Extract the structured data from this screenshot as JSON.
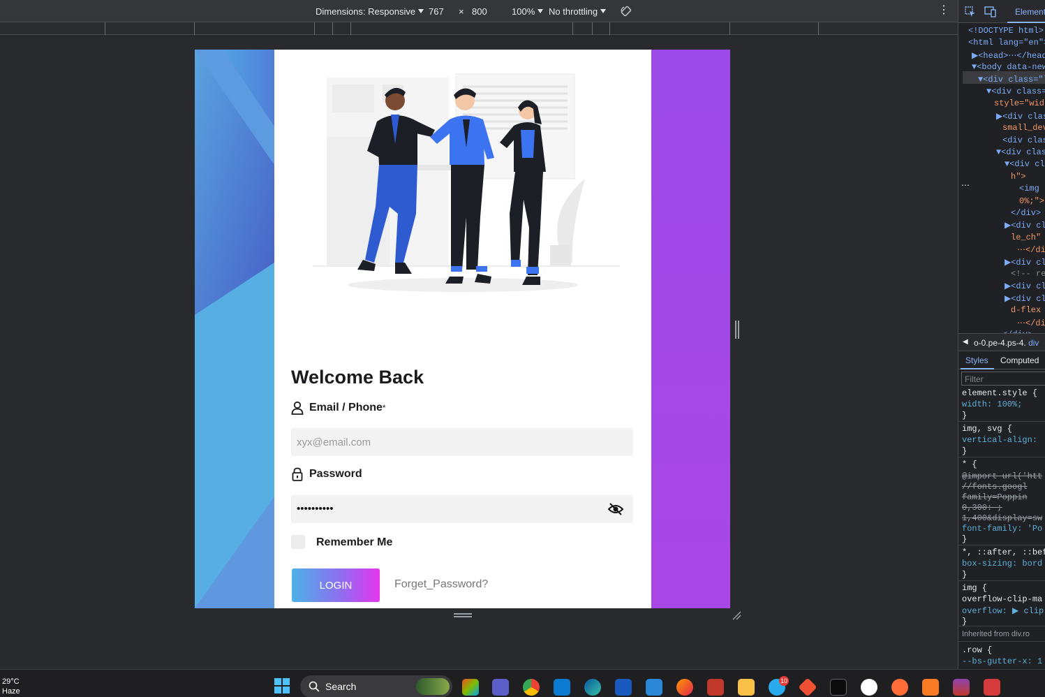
{
  "devtools": {
    "dimensions_label": "Dimensions: Responsive",
    "width_value": "767",
    "times": "×",
    "height_value": "800",
    "zoom": "100%",
    "throttling": "No throttling",
    "elements_tab": "Elements",
    "dom_lines": [
      {
        "t": "<!DOCTYPE html>"
      },
      {
        "t": "<html lang=\"en\">"
      },
      {
        "t": "▶<head>⋯</head>"
      },
      {
        "t": "▼<body data-new-"
      },
      {
        "t": "▼<div class=\"l"
      },
      {
        "t": "▼<div class="
      },
      {
        "t": "style=\"widt"
      },
      {
        "t": "▶<div class"
      },
      {
        "t": "small_devi"
      },
      {
        "t": "<div class"
      },
      {
        "t": "▼<div class"
      },
      {
        "t": "▼<div cla"
      },
      {
        "t": "h\">"
      },
      {
        "t": "<img s"
      },
      {
        "t": "0%;\">"
      },
      {
        "t": "</div>"
      },
      {
        "t": "▶<div cla"
      },
      {
        "t": "le_ch\" s"
      },
      {
        "t": "⋯</div"
      },
      {
        "t": "▶<div cla"
      },
      {
        "t": "<!-- res"
      },
      {
        "t": "▶<div cla"
      },
      {
        "t": "▶<div cla"
      },
      {
        "t": "d-flex a"
      },
      {
        "t": "⋯</div"
      },
      {
        "t": "</div>"
      }
    ],
    "breadcrumb": "o-0.pe-4.ps-4.",
    "breadcrumb_tail": "div",
    "styles_tab": "Styles",
    "computed_tab": "Computed",
    "filter_placeholder": "Filter",
    "css_lines": [
      {
        "t": "element.style {"
      },
      {
        "t": "  width: 100%;"
      },
      {
        "t": "}"
      },
      {
        "t": "img, svg {"
      },
      {
        "t": "  vertical-align:"
      },
      {
        "t": "}"
      },
      {
        "t": "* {"
      },
      {
        "t": "@import url('htt"
      },
      {
        "t": "  //fonts.googl"
      },
      {
        "t": "  family=Poppin"
      },
      {
        "t": "0,300: ;"
      },
      {
        "t": "1,400&display=sw"
      },
      {
        "t": "  font-family: 'Po"
      },
      {
        "t": "}"
      },
      {
        "t": "*, ::after, ::befo"
      },
      {
        "t": "  box-sizing: bord"
      },
      {
        "t": "}"
      },
      {
        "t": "img {"
      },
      {
        "t": "  overflow-clip-ma"
      },
      {
        "t": "  overflow: ▶ clip"
      },
      {
        "t": "}"
      },
      {
        "t": "Inherited from div.ro"
      },
      {
        "t": ".row {"
      },
      {
        "t": "  --bs-gutter-x: 1"
      }
    ]
  },
  "page": {
    "welcome": "Welcome Back",
    "email_label": "Email / Phone",
    "required_mark": "*",
    "email_placeholder": "xyx@email.com",
    "password_label": "Password",
    "password_value": "••••••••••",
    "remember_label": "Remember Me",
    "login_button": "LOGIN",
    "forgot_link": "Forget_Password?"
  },
  "taskbar": {
    "temperature": "29°C",
    "condition": "Haze",
    "search_label": "Search",
    "telegram_badge": "10",
    "apps": [
      "windows-icon",
      "copilot-icon",
      "teams-icon",
      "chrome-icon",
      "vscode-icon",
      "edge-icon",
      "word-icon",
      "terminal-app-icon",
      "firefox-icon",
      "app-icon",
      "file-explorer-icon",
      "telegram-icon",
      "git-icon",
      "cmd-icon",
      "mongodb-icon",
      "postman-icon",
      "xampp-icon",
      "winrar-icon",
      "snipping-icon"
    ]
  },
  "colors": {
    "accent_blue": "#8ab4f8",
    "login_gradient_start": "#4db2e6",
    "login_gradient_end": "#e436ee",
    "right_panel_purple": "#a946e6"
  }
}
